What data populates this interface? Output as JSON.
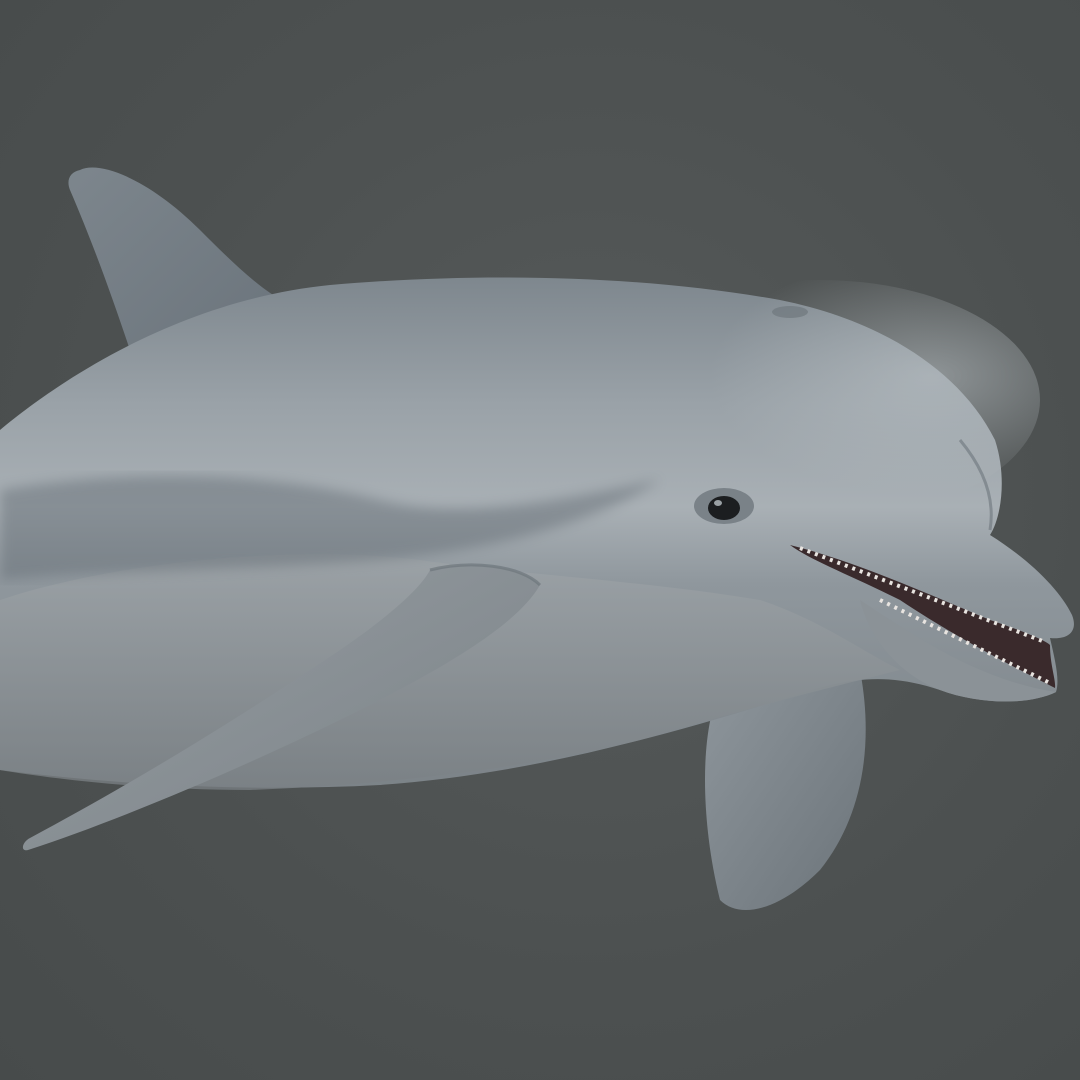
{
  "scene": {
    "subject": "dolphin-render",
    "background_color": "#4e5252",
    "colors": {
      "body_top": "#8e979e",
      "body_mid": "#a4acb2",
      "belly": "#8c9296",
      "dark_stripe": "#5f6870",
      "fin": "#8a9197",
      "mouth": "#3a2a2c",
      "teeth": "#e8e4e0",
      "eye": "#1c1e20"
    }
  }
}
